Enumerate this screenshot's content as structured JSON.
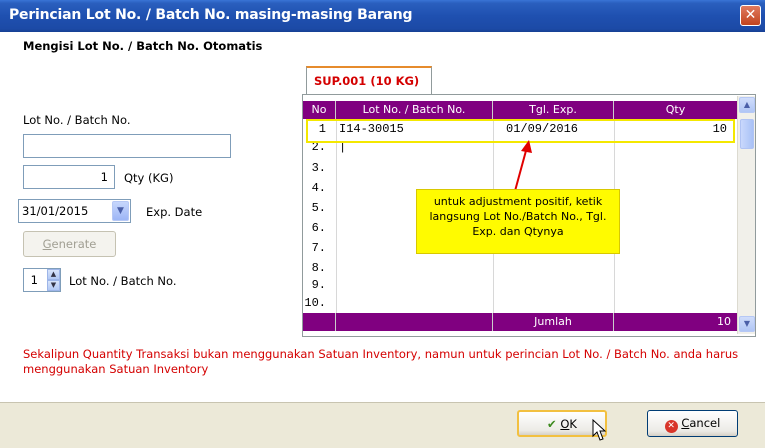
{
  "window": {
    "title": "Perincian Lot No. / Batch No. masing-masing Barang",
    "close_glyph": "✕"
  },
  "left": {
    "heading": "Mengisi Lot No. / Batch No. Otomatis",
    "lot_label": "Lot No. / Batch No.",
    "lot_value": "",
    "qty_value": "1",
    "qty_label": "Qty (KG)",
    "date_value": "31/01/2015",
    "date_label": "Exp. Date",
    "generate_label": "Generate",
    "generate_accel": "G",
    "generate_rest": "enerate",
    "spin_value": "1",
    "spin_label": "Lot No. / Batch No."
  },
  "tab": {
    "label": "SUP.001 (10 KG)"
  },
  "grid": {
    "columns": [
      "No",
      "Lot No. / Batch No.",
      "Tgl. Exp.",
      "Qty"
    ],
    "rows": [
      {
        "no": "1",
        "lot": "I14-30015",
        "exp": "01/09/2016",
        "qty": "10"
      },
      {
        "no": "2.",
        "lot": "|",
        "exp": "",
        "qty": ""
      },
      {
        "no": "3.",
        "lot": "",
        "exp": "",
        "qty": ""
      },
      {
        "no": "4.",
        "lot": "",
        "exp": "",
        "qty": ""
      },
      {
        "no": "5.",
        "lot": "",
        "exp": "",
        "qty": ""
      },
      {
        "no": "6.",
        "lot": "",
        "exp": "",
        "qty": ""
      },
      {
        "no": "7.",
        "lot": "",
        "exp": "",
        "qty": ""
      },
      {
        "no": "8.",
        "lot": "",
        "exp": "",
        "qty": ""
      },
      {
        "no": "9.",
        "lot": "",
        "exp": "",
        "qty": ""
      },
      {
        "no": "10.",
        "lot": "",
        "exp": "",
        "qty": ""
      }
    ],
    "footer_label": "Jumlah",
    "footer_total": "10"
  },
  "callout": "untuk adjustment positif, ketik langsung Lot No./Batch No., Tgl. Exp. dan Qtynya",
  "note": "Sekalipun Quantity Transaksi bukan menggunakan Satuan Inventory, namun untuk perincian Lot No. / Batch No. anda harus menggunakan Satuan Inventory",
  "buttons": {
    "ok_accel": "O",
    "ok_rest": "K",
    "cancel_accel": "C",
    "cancel_rest": "ancel"
  },
  "colors": {
    "grid_header": "#800080",
    "tab_text": "#D40000",
    "note_text": "#D40000",
    "callout_bg": "#FFFB00",
    "highlight": "#F4E800"
  }
}
